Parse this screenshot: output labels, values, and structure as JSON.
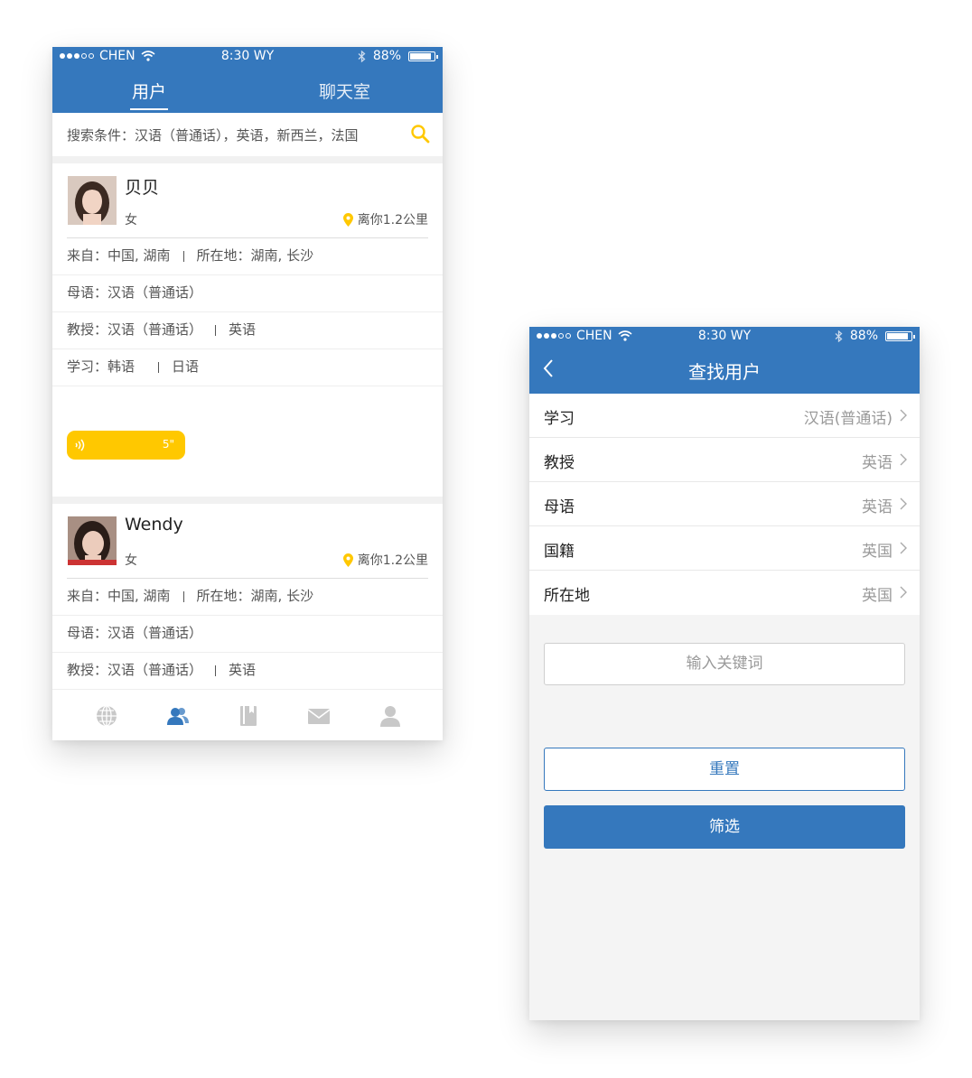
{
  "status_bar": {
    "carrier": "CHEN",
    "time": "8:30 WY",
    "battery": "88%"
  },
  "screen_users": {
    "tabs": [
      {
        "label": "用户",
        "active": true
      },
      {
        "label": "聊天室",
        "active": false
      }
    ],
    "search": {
      "text": "搜索条件：汉语（普通话），英语，新西兰，法国"
    },
    "users": [
      {
        "name": "贝贝",
        "gender": "女",
        "distance": "离你1.2公里",
        "from_label": "来自：中国, 湖南",
        "location_label": "所在地：湖南, 长沙",
        "native": "母语：汉语（普通话）",
        "teach_label": "教授：汉语（普通话）",
        "teach_extra": "英语",
        "learn_label": "学习：韩语",
        "learn_extra": "日语",
        "voice_seconds": "5\""
      },
      {
        "name": "Wendy",
        "gender": "女",
        "distance": "离你1.2公里",
        "from_label": "来自：中国, 湖南",
        "location_label": "所在地：湖南, 长沙",
        "native": "母语：汉语（普通话）",
        "teach_label": "教授：汉语（普通话）",
        "teach_extra": "英语"
      }
    ],
    "bottom_nav": [
      "globe-icon",
      "users-icon",
      "book-icon",
      "mail-icon",
      "profile-icon"
    ]
  },
  "screen_find": {
    "title": "查找用户",
    "filters": [
      {
        "label": "学习",
        "value": "汉语(普通话)"
      },
      {
        "label": "教授",
        "value": "英语"
      },
      {
        "label": "母语",
        "value": "英语"
      },
      {
        "label": "国籍",
        "value": "英国"
      },
      {
        "label": "所在地",
        "value": "英国"
      }
    ],
    "keyword_placeholder": "输入关键词",
    "reset_label": "重置",
    "filter_label": "筛选"
  },
  "colors": {
    "primary": "#3578bd",
    "accent": "#ffc800"
  }
}
